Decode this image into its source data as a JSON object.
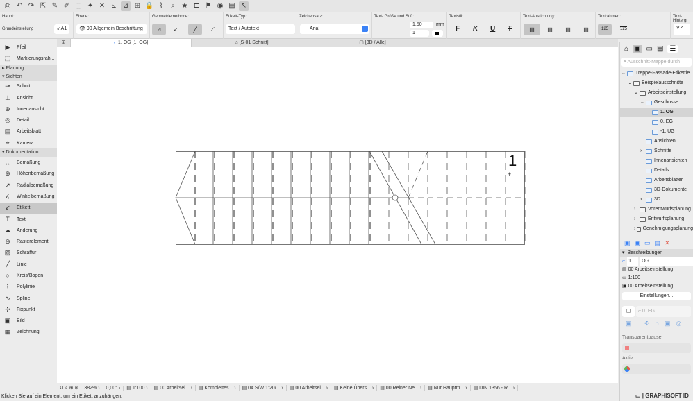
{
  "toolbar": {
    "icons": [
      "save-icon",
      "undo-icon",
      "redo-icon",
      "arrow-icon",
      "pipette-icon",
      "syringe-icon",
      "marquee-icon",
      "magic-wand-icon",
      "cross-icon",
      "snap-icon",
      "guide-icon",
      "grid-icon",
      "lock-icon",
      "trim-icon",
      "measure-icon",
      "star-icon",
      "label-icon",
      "flag-icon",
      "eye-icon",
      "layers-icon",
      "cursor-icon"
    ]
  },
  "infobox": {
    "haupt": {
      "label": "Haupt:",
      "value": "Grundeinstellung",
      "tool_glyph": "↙A1"
    },
    "ebene": {
      "label": "Ebene:",
      "value": "90 Allgemein Beschriftung"
    },
    "geometrie": {
      "label": "Geometriemethode:"
    },
    "etikett_typ": {
      "label": "Etikett-Typ:",
      "value": "Text / Autotext"
    },
    "zeichensatz": {
      "label": "Zeichensatz:",
      "value": "Arial"
    },
    "groesse": {
      "label": "Text- Größe und Stift:",
      "size": "1,50",
      "unit": "mm",
      "pen": "1"
    },
    "textstil": {
      "label": "Textstil:",
      "bold": "F",
      "italic": "K",
      "underline": "U",
      "strike": "T"
    },
    "ausrichtung": {
      "label": "Text-Ausrichtung:"
    },
    "textrahmen": {
      "label": "Textrahmen:",
      "a": "125",
      "b": "125"
    },
    "hintergrund": {
      "label": "Text-Hintergr"
    }
  },
  "tabs": [
    {
      "label": "1. OG [1. OG]",
      "active": true
    },
    {
      "label": "[S-01 Schnitt]"
    },
    {
      "label": "[3D / Alle]"
    }
  ],
  "toolbox": {
    "top": [
      {
        "label": "Pfeil",
        "icon": "▶"
      },
      {
        "label": "Markierungsrah...",
        "icon": "⬚"
      }
    ],
    "sections": [
      {
        "name": "Planung",
        "items": []
      },
      {
        "name": "Sichten",
        "items": [
          {
            "label": "Schnitt",
            "icon": "⊸"
          },
          {
            "label": "Ansicht",
            "icon": "⊥"
          },
          {
            "label": "Innenansicht",
            "icon": "⊕"
          },
          {
            "label": "Detail",
            "icon": "◎"
          },
          {
            "label": "Arbeitsblatt",
            "icon": "▤"
          },
          {
            "label": "Kamera",
            "icon": "⌖"
          }
        ]
      },
      {
        "name": "Dokumentation",
        "items": [
          {
            "label": "Bemaßung",
            "icon": "↔"
          },
          {
            "label": "Höhenbemaßung",
            "icon": "⊕"
          },
          {
            "label": "Radialbemaßung",
            "icon": "↗"
          },
          {
            "label": "Winkelbemaßung",
            "icon": "∡"
          },
          {
            "label": "Etikett",
            "icon": "↙",
            "selected": true
          },
          {
            "label": "Text",
            "icon": "T"
          },
          {
            "label": "Änderung",
            "icon": "☁"
          },
          {
            "label": "Rasterelement",
            "icon": "⊖"
          },
          {
            "label": "Schraffur",
            "icon": "▨"
          },
          {
            "label": "Linie",
            "icon": "╱"
          },
          {
            "label": "Kreis/Bogen",
            "icon": "○"
          },
          {
            "label": "Polylinie",
            "icon": "⌇"
          },
          {
            "label": "Spline",
            "icon": "∿"
          },
          {
            "label": "Fixpunkt",
            "icon": "✣"
          },
          {
            "label": "Bild",
            "icon": "▣"
          },
          {
            "label": "Zeichnung",
            "icon": "▦"
          }
        ]
      }
    ]
  },
  "canvas": {
    "story_label": "1"
  },
  "status": [
    {
      "label": "382%"
    },
    {
      "label": "0,00°"
    },
    {
      "label": "1:100"
    },
    {
      "label": "00 Arbeitsei..."
    },
    {
      "label": "Komplettes..."
    },
    {
      "label": "04 S/W 1:20/..."
    },
    {
      "label": "00 Arbeitsei..."
    },
    {
      "label": "Keine Übers..."
    },
    {
      "label": "00 Reiner Ne..."
    },
    {
      "label": "Nur Hauptm..."
    },
    {
      "label": "DIN 1356 - R..."
    }
  ],
  "hint": "Klicken Sie auf ein Element, um ein Etikett anzuhängen.",
  "brand": "GRAPHISOFT ID",
  "navigator": {
    "search_placeholder": "Ausschnitt-Mappe durch",
    "tree": [
      {
        "label": "Treppe-Fassade-Etikettie",
        "depth": 0,
        "arrow": "⌄"
      },
      {
        "label": "Beispielausschnitte",
        "depth": 1,
        "arrow": "⌄",
        "gray": true
      },
      {
        "label": "Arbeitseinstellung",
        "depth": 2,
        "arrow": "⌄",
        "gray": true
      },
      {
        "label": "Geschosse",
        "depth": 3,
        "arrow": "⌄"
      },
      {
        "label": "1. OG",
        "depth": 4,
        "selected": true
      },
      {
        "label": "0. EG",
        "depth": 4
      },
      {
        "label": "-1. UG",
        "depth": 4
      },
      {
        "label": "Ansichten",
        "depth": 3
      },
      {
        "label": "Schnitte",
        "depth": 3,
        "arrow": "›"
      },
      {
        "label": "Innenansichten",
        "depth": 3
      },
      {
        "label": "Details",
        "depth": 3
      },
      {
        "label": "Arbeitsblätter",
        "depth": 3
      },
      {
        "label": "3D-Dokumente",
        "depth": 3
      },
      {
        "label": "3D",
        "depth": 3,
        "arrow": "›"
      },
      {
        "label": "Vorentwurfsplanung",
        "depth": 2,
        "arrow": "›",
        "gray": true
      },
      {
        "label": "Entwurfsplanung",
        "depth": 2,
        "arrow": "›",
        "gray": true
      },
      {
        "label": "Genehmigungsplanung",
        "depth": 2,
        "arrow": "›",
        "gray": true
      }
    ],
    "section": "Beschreibungen",
    "id": "1.",
    "name": "OG",
    "layer": "00 Arbeitseinstellung",
    "scale": "1:100",
    "model": "00 Arbeitseinstellung",
    "settings_button": "Einstellungen...",
    "ref": "0. EG",
    "trans_label": "Transparentpause:",
    "aktiv_label": "Aktiv:"
  },
  "colors": {
    "accent": "#3b82f6",
    "delete": "#e05a4a",
    "selected": "#c8c8c8"
  }
}
